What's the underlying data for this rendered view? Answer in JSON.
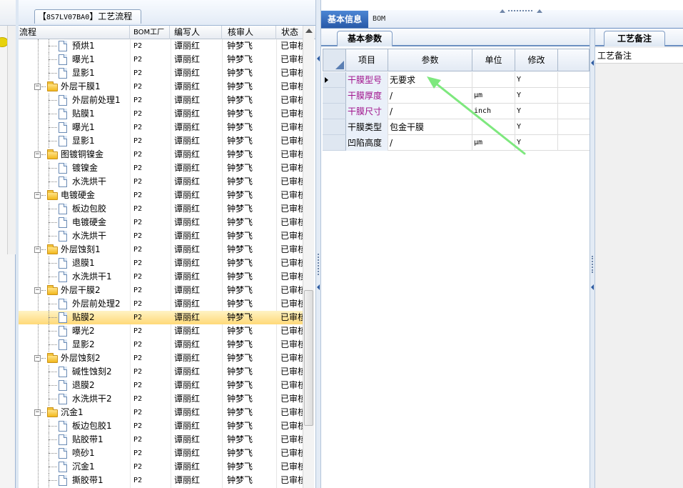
{
  "left_panel": {
    "title_prefix": "【",
    "title_code": "8S7LV07BA0",
    "title_suffix": "】工艺流程",
    "columns": [
      "流程",
      "BOM工厂",
      "编写人",
      "核审人",
      "状态"
    ],
    "rows": [
      {
        "name": "预烘1",
        "type": "doc",
        "factory": "P2",
        "author": "谭丽红",
        "reviewer": "钟梦飞",
        "status": "已审核"
      },
      {
        "name": "曝光1",
        "type": "doc",
        "factory": "P2",
        "author": "谭丽红",
        "reviewer": "钟梦飞",
        "status": "已审核"
      },
      {
        "name": "显影1",
        "type": "doc",
        "factory": "P2",
        "author": "谭丽红",
        "reviewer": "钟梦飞",
        "status": "已审核"
      },
      {
        "name": "外层干膜1",
        "type": "folder",
        "factory": "P2",
        "author": "谭丽红",
        "reviewer": "钟梦飞",
        "status": "已审核"
      },
      {
        "name": "外层前处理1",
        "type": "doc",
        "factory": "P2",
        "author": "谭丽红",
        "reviewer": "钟梦飞",
        "status": "已审核"
      },
      {
        "name": "贴膜1",
        "type": "doc",
        "factory": "P2",
        "author": "谭丽红",
        "reviewer": "钟梦飞",
        "status": "已审核"
      },
      {
        "name": "曝光1",
        "type": "doc",
        "factory": "P2",
        "author": "谭丽红",
        "reviewer": "钟梦飞",
        "status": "已审核"
      },
      {
        "name": "显影1",
        "type": "doc",
        "factory": "P2",
        "author": "谭丽红",
        "reviewer": "钟梦飞",
        "status": "已审核"
      },
      {
        "name": "图镀铜镍金",
        "type": "folder",
        "factory": "P2",
        "author": "谭丽红",
        "reviewer": "钟梦飞",
        "status": "已审核"
      },
      {
        "name": "镀镍金",
        "type": "doc",
        "factory": "P2",
        "author": "谭丽红",
        "reviewer": "钟梦飞",
        "status": "已审核"
      },
      {
        "name": "水洗烘干",
        "type": "doc",
        "factory": "P2",
        "author": "谭丽红",
        "reviewer": "钟梦飞",
        "status": "已审核"
      },
      {
        "name": "电镀硬金",
        "type": "folder",
        "factory": "P2",
        "author": "谭丽红",
        "reviewer": "钟梦飞",
        "status": "已审核"
      },
      {
        "name": "板边包胶",
        "type": "doc",
        "factory": "P2",
        "author": "谭丽红",
        "reviewer": "钟梦飞",
        "status": "已审核"
      },
      {
        "name": "电镀硬金",
        "type": "doc",
        "factory": "P2",
        "author": "谭丽红",
        "reviewer": "钟梦飞",
        "status": "已审核"
      },
      {
        "name": "水洗烘干",
        "type": "doc",
        "factory": "P2",
        "author": "谭丽红",
        "reviewer": "钟梦飞",
        "status": "已审核"
      },
      {
        "name": "外层蚀刻1",
        "type": "folder",
        "factory": "P2",
        "author": "谭丽红",
        "reviewer": "钟梦飞",
        "status": "已审核"
      },
      {
        "name": "退膜1",
        "type": "doc",
        "factory": "P2",
        "author": "谭丽红",
        "reviewer": "钟梦飞",
        "status": "已审核"
      },
      {
        "name": "水洗烘干1",
        "type": "doc",
        "factory": "P2",
        "author": "谭丽红",
        "reviewer": "钟梦飞",
        "status": "已审核"
      },
      {
        "name": "外层干膜2",
        "type": "folder",
        "factory": "P2",
        "author": "谭丽红",
        "reviewer": "钟梦飞",
        "status": "已审核"
      },
      {
        "name": "外层前处理2",
        "type": "doc",
        "factory": "P2",
        "author": "谭丽红",
        "reviewer": "钟梦飞",
        "status": "已审核"
      },
      {
        "name": "贴膜2",
        "type": "doc",
        "factory": "P2",
        "author": "谭丽红",
        "reviewer": "钟梦飞",
        "status": "已审核",
        "selected": true
      },
      {
        "name": "曝光2",
        "type": "doc",
        "factory": "P2",
        "author": "谭丽红",
        "reviewer": "钟梦飞",
        "status": "已审核"
      },
      {
        "name": "显影2",
        "type": "doc",
        "factory": "P2",
        "author": "谭丽红",
        "reviewer": "钟梦飞",
        "status": "已审核"
      },
      {
        "name": "外层蚀刻2",
        "type": "folder",
        "factory": "P2",
        "author": "谭丽红",
        "reviewer": "钟梦飞",
        "status": "已审核"
      },
      {
        "name": "碱性蚀刻2",
        "type": "doc",
        "factory": "P2",
        "author": "谭丽红",
        "reviewer": "钟梦飞",
        "status": "已审核"
      },
      {
        "name": "退膜2",
        "type": "doc",
        "factory": "P2",
        "author": "谭丽红",
        "reviewer": "钟梦飞",
        "status": "已审核"
      },
      {
        "name": "水洗烘干2",
        "type": "doc",
        "factory": "P2",
        "author": "谭丽红",
        "reviewer": "钟梦飞",
        "status": "已审核"
      },
      {
        "name": "沉金1",
        "type": "folder",
        "factory": "P2",
        "author": "谭丽红",
        "reviewer": "钟梦飞",
        "status": "已审核"
      },
      {
        "name": "板边包胶1",
        "type": "doc",
        "factory": "P2",
        "author": "谭丽红",
        "reviewer": "钟梦飞",
        "status": "已审核"
      },
      {
        "name": "贴胶带1",
        "type": "doc",
        "factory": "P2",
        "author": "谭丽红",
        "reviewer": "钟梦飞",
        "status": "已审核"
      },
      {
        "name": "喷砂1",
        "type": "doc",
        "factory": "P2",
        "author": "谭丽红",
        "reviewer": "钟梦飞",
        "status": "已审核"
      },
      {
        "name": "沉金1",
        "type": "doc",
        "factory": "P2",
        "author": "谭丽红",
        "reviewer": "钟梦飞",
        "status": "已审核"
      },
      {
        "name": "撕胶带1",
        "type": "doc",
        "factory": "P2",
        "author": "谭丽红",
        "reviewer": "钟梦飞",
        "status": "已审核"
      }
    ]
  },
  "main_tabs": {
    "basic": "基本信息",
    "bom": "BOM"
  },
  "params_panel": {
    "subtab": "基本参数",
    "columns": [
      "项目",
      "参数",
      "单位",
      "修改"
    ],
    "rows": [
      {
        "item": "干膜型号",
        "value": "无要求",
        "unit": "",
        "modify": "Y",
        "highlight": true,
        "current": true
      },
      {
        "item": "干膜厚度",
        "value": "/",
        "unit": "μm",
        "modify": "Y",
        "highlight": true
      },
      {
        "item": "干膜尺寸",
        "value": "/",
        "unit": "inch",
        "modify": "Y",
        "highlight": true
      },
      {
        "item": "干膜类型",
        "value": "包金干膜",
        "unit": "",
        "modify": "Y",
        "highlight": false
      },
      {
        "item": "凹陷高度",
        "value": "/",
        "unit": "μm",
        "modify": "Y",
        "highlight": false
      }
    ]
  },
  "notes_panel": {
    "tab": "工艺备注",
    "label": "工艺备注"
  },
  "colors": {
    "highlight_text": "#a0128c",
    "selected_row": "#ffd978",
    "active_tab": "#2859a8",
    "annotation_arrow": "#7ee87e"
  }
}
